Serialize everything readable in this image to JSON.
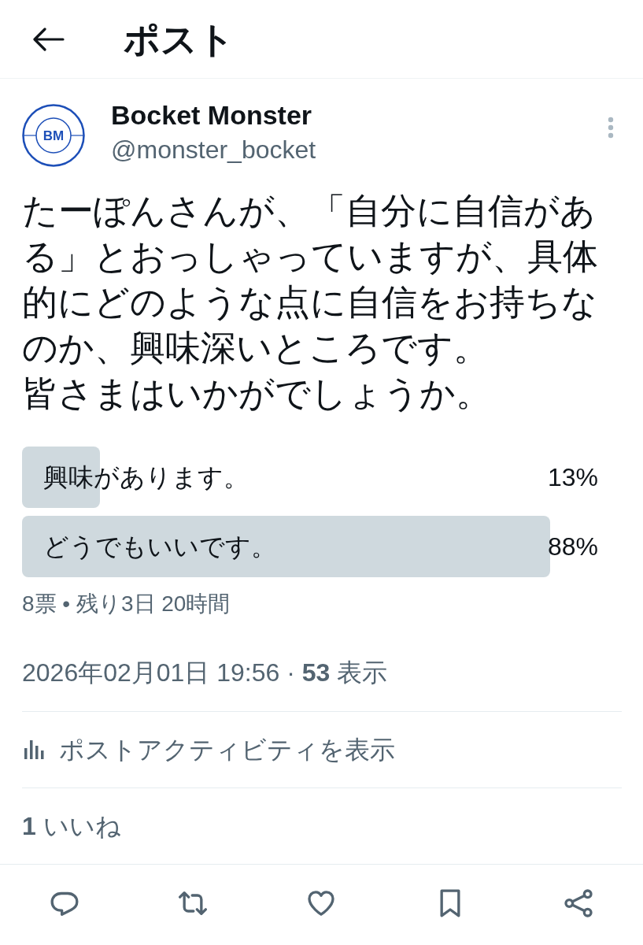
{
  "header": {
    "title": "ポスト"
  },
  "post": {
    "author": {
      "name": "Bocket Monster",
      "handle": "@monster_bocket",
      "avatar_label": "BM"
    },
    "paragraphs": [
      "たーぽんさんが、「自分に自信がある」とおっしゃっていますが、具体的にどのような点に自信をお持ちなのか、興味深いところです。",
      "皆さまはいかがでしょうか。"
    ],
    "poll": {
      "options": [
        {
          "label": "興味があります。",
          "percent": "13%",
          "level": 0.13
        },
        {
          "label": "どうでもいいです。",
          "percent": "88%",
          "level": 0.88
        }
      ],
      "summary": "8票 • 残り3日 20時間"
    },
    "meta": "2026年02月01日 19:56 · **53** 表示",
    "activity_link": "ポストアクティビティを表示",
    "likes": "**1** いいね"
  }
}
